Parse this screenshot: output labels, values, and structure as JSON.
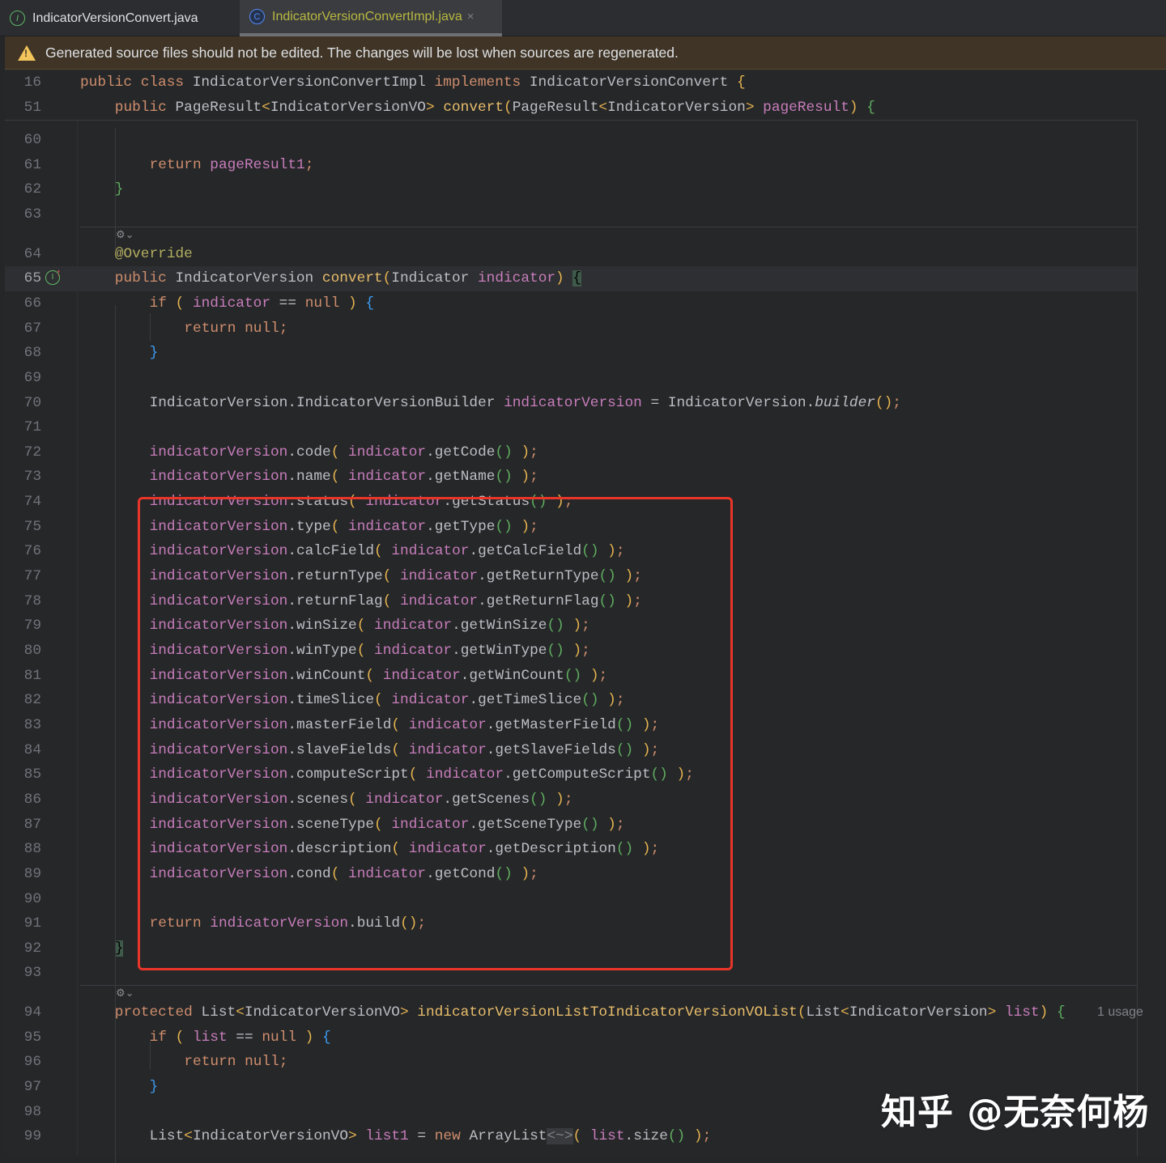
{
  "tabs": [
    {
      "label": "IndicatorVersionConvert.java",
      "icon": "interface-icon",
      "glyph": "I",
      "active": false
    },
    {
      "label": "IndicatorVersionConvertImpl.java",
      "icon": "class-icon",
      "glyph": "C",
      "active": true,
      "close": "×"
    }
  ],
  "banner": {
    "text": "Generated source files should not be edited. The changes will be lost when sources are regenerated.",
    "icon": "warning-icon"
  },
  "sticky": [
    {
      "n": "16",
      "tokens": [
        [
          "k",
          "public class "
        ],
        [
          "t",
          "IndicatorVersionConvertImpl "
        ],
        [
          "k",
          "implements "
        ],
        [
          "t",
          "IndicatorVersionConvert "
        ],
        [
          "y",
          "{"
        ]
      ]
    },
    {
      "n": "51",
      "indent": 1,
      "tokens": [
        [
          "k",
          "public "
        ],
        [
          "t",
          "PageResult"
        ],
        [
          "y",
          "<"
        ],
        [
          "t",
          "IndicatorVersionVO"
        ],
        [
          "y",
          "> "
        ],
        [
          "f",
          "convert"
        ],
        [
          "y",
          "("
        ],
        [
          "t",
          "PageResult"
        ],
        [
          "y",
          "<"
        ],
        [
          "t",
          "IndicatorVersion"
        ],
        [
          "y",
          "> "
        ],
        [
          "v",
          "pageResult"
        ],
        [
          "y",
          ")"
        ],
        [
          "t",
          " "
        ],
        [
          "g",
          "{"
        ]
      ]
    }
  ],
  "lines": [
    {
      "n": "60",
      "tokens": []
    },
    {
      "n": "61",
      "indent": 2,
      "tokens": [
        [
          "k",
          "return "
        ],
        [
          "v",
          "pageResult1"
        ],
        [
          "k",
          ";"
        ]
      ]
    },
    {
      "n": "62",
      "indent": 1,
      "tokens": [
        [
          "g",
          "}"
        ]
      ]
    },
    {
      "n": "63",
      "tokens": []
    },
    {
      "sep": true
    },
    {
      "n": "64",
      "indent": 1,
      "tokens": [
        [
          "a",
          "@Override"
        ]
      ]
    },
    {
      "n": "65",
      "indent": 1,
      "current": true,
      "gutter_icon": "implements-method-icon",
      "gutter_glyph": "I",
      "tokens": [
        [
          "k",
          "public "
        ],
        [
          "t",
          "IndicatorVersion "
        ],
        [
          "f",
          "convert"
        ],
        [
          "y",
          "("
        ],
        [
          "t",
          "Indicator "
        ],
        [
          "v",
          "indicator"
        ],
        [
          "y",
          ")"
        ],
        [
          "t",
          " "
        ],
        [
          "hl",
          "{"
        ]
      ]
    },
    {
      "n": "66",
      "indent": 2,
      "tokens": [
        [
          "k",
          "if "
        ],
        [
          "y",
          "( "
        ],
        [
          "v",
          "indicator"
        ],
        [
          "t",
          " == "
        ],
        [
          "k",
          "null"
        ],
        [
          "y",
          " )"
        ],
        [
          "t",
          " "
        ],
        [
          "b",
          "{"
        ]
      ]
    },
    {
      "n": "67",
      "indent": 3,
      "tokens": [
        [
          "k",
          "return null;"
        ]
      ]
    },
    {
      "n": "68",
      "indent": 2,
      "tokens": [
        [
          "b",
          "}"
        ]
      ]
    },
    {
      "n": "69",
      "tokens": []
    },
    {
      "n": "70",
      "indent": 2,
      "tokens": [
        [
          "t",
          "IndicatorVersion.IndicatorVersionBuilder "
        ],
        [
          "v",
          "indicatorVersion"
        ],
        [
          "t",
          " = IndicatorVersion."
        ],
        [
          "i",
          "builder"
        ],
        [
          "y",
          "()"
        ],
        [
          "k",
          ";"
        ]
      ]
    },
    {
      "n": "71",
      "tokens": []
    },
    {
      "n": "72",
      "setter": [
        "code",
        "getCode"
      ]
    },
    {
      "n": "73",
      "setter": [
        "name",
        "getName"
      ]
    },
    {
      "n": "74",
      "setter": [
        "status",
        "getStatus"
      ]
    },
    {
      "n": "75",
      "setter": [
        "type",
        "getType"
      ]
    },
    {
      "n": "76",
      "setter": [
        "calcField",
        "getCalcField"
      ]
    },
    {
      "n": "77",
      "setter": [
        "returnType",
        "getReturnType"
      ]
    },
    {
      "n": "78",
      "setter": [
        "returnFlag",
        "getReturnFlag"
      ]
    },
    {
      "n": "79",
      "setter": [
        "winSize",
        "getWinSize"
      ]
    },
    {
      "n": "80",
      "setter": [
        "winType",
        "getWinType"
      ]
    },
    {
      "n": "81",
      "setter": [
        "winCount",
        "getWinCount"
      ]
    },
    {
      "n": "82",
      "setter": [
        "timeSlice",
        "getTimeSlice"
      ]
    },
    {
      "n": "83",
      "setter": [
        "masterField",
        "getMasterField"
      ]
    },
    {
      "n": "84",
      "setter": [
        "slaveFields",
        "getSlaveFields"
      ]
    },
    {
      "n": "85",
      "setter": [
        "computeScript",
        "getComputeScript"
      ]
    },
    {
      "n": "86",
      "setter": [
        "scenes",
        "getScenes"
      ]
    },
    {
      "n": "87",
      "setter": [
        "sceneType",
        "getSceneType"
      ]
    },
    {
      "n": "88",
      "setter": [
        "description",
        "getDescription"
      ]
    },
    {
      "n": "89",
      "setter": [
        "cond",
        "getCond"
      ]
    },
    {
      "n": "90",
      "tokens": []
    },
    {
      "n": "91",
      "indent": 2,
      "tokens": [
        [
          "k",
          "return "
        ],
        [
          "v",
          "indicatorVersion"
        ],
        [
          "t",
          ".build"
        ],
        [
          "y",
          "()"
        ],
        [
          "k",
          ";"
        ]
      ]
    },
    {
      "n": "92",
      "indent": 1,
      "tokens": [
        [
          "hl",
          "}"
        ]
      ]
    },
    {
      "n": "93",
      "tokens": []
    },
    {
      "sep": true
    },
    {
      "n": "94",
      "indent": 1,
      "hint": "1 usage",
      "tokens": [
        [
          "k",
          "protected "
        ],
        [
          "t",
          "List"
        ],
        [
          "y",
          "<"
        ],
        [
          "t",
          "IndicatorVersionVO"
        ],
        [
          "y",
          "> "
        ],
        [
          "f",
          "indicatorVersionListToIndicatorVersionVOList"
        ],
        [
          "y",
          "("
        ],
        [
          "t",
          "List"
        ],
        [
          "y",
          "<"
        ],
        [
          "t",
          "IndicatorVersion"
        ],
        [
          "y",
          "> "
        ],
        [
          "v",
          "list"
        ],
        [
          "y",
          ")"
        ],
        [
          "t",
          " "
        ],
        [
          "g",
          "{"
        ]
      ]
    },
    {
      "n": "95",
      "indent": 2,
      "tokens": [
        [
          "k",
          "if "
        ],
        [
          "y",
          "( "
        ],
        [
          "v",
          "list"
        ],
        [
          "t",
          " == "
        ],
        [
          "k",
          "null"
        ],
        [
          "y",
          " )"
        ],
        [
          "t",
          " "
        ],
        [
          "b",
          "{"
        ]
      ]
    },
    {
      "n": "96",
      "indent": 3,
      "tokens": [
        [
          "k",
          "return null;"
        ]
      ]
    },
    {
      "n": "97",
      "indent": 2,
      "tokens": [
        [
          "b",
          "}"
        ]
      ]
    },
    {
      "n": "98",
      "tokens": []
    },
    {
      "n": "99",
      "indent": 2,
      "tokens": [
        [
          "t",
          "List"
        ],
        [
          "y",
          "<"
        ],
        [
          "t",
          "IndicatorVersionVO"
        ],
        [
          "y",
          "> "
        ],
        [
          "v",
          "list1"
        ],
        [
          "t",
          " = "
        ],
        [
          "k",
          "new "
        ],
        [
          "t",
          "ArrayList"
        ],
        [
          "gr",
          "<~>"
        ],
        [
          "y",
          "( "
        ],
        [
          "v",
          "list"
        ],
        [
          "t",
          ".size"
        ],
        [
          "g",
          "()"
        ],
        [
          "y",
          " )"
        ],
        [
          "k",
          ";"
        ]
      ]
    }
  ],
  "setter_var": "indicatorVersion",
  "setter_arg": "indicator",
  "watermark": "知乎 @无奈何杨"
}
